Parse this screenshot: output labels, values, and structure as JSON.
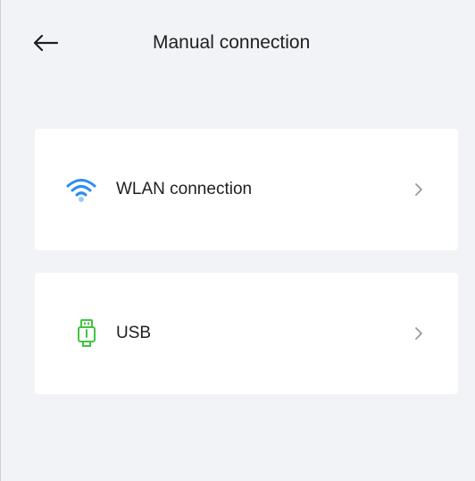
{
  "header": {
    "back_icon": "back-arrow-icon",
    "title": "Manual connection"
  },
  "connections": [
    {
      "label": "WLAN connection",
      "icon": "wifi-icon",
      "icon_color": "#2e8df0",
      "chevron_icon": "chevron-right-icon"
    },
    {
      "label": "USB",
      "icon": "usb-icon",
      "icon_color": "#43c343",
      "chevron_icon": "chevron-right-icon"
    }
  ],
  "colors": {
    "background": "#f2f3f7",
    "card": "#ffffff",
    "text": "#1f1f1f",
    "chevron": "#9a9a9a"
  }
}
